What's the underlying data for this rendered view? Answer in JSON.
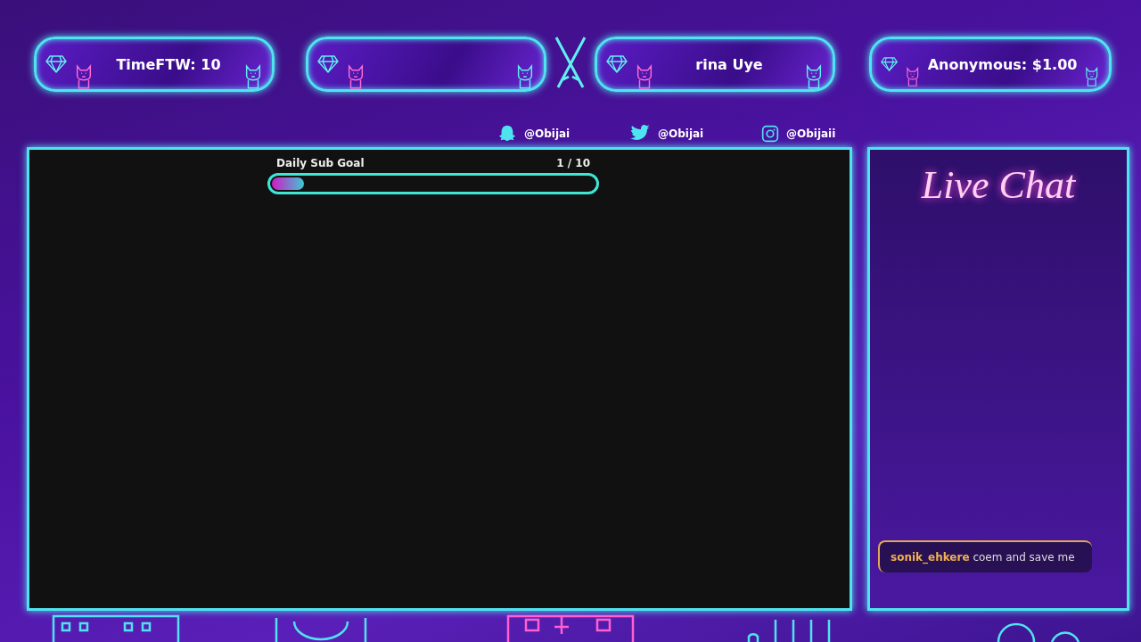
{
  "banners": [
    {
      "kind": "message",
      "text": "TimeFTW: 10"
    },
    {
      "kind": "blank"
    },
    {
      "kind": "message",
      "text": "rina Uye"
    },
    {
      "kind": "message",
      "text": "Anonymous: $1.00"
    }
  ],
  "socials": [
    {
      "kind": "snapchat",
      "handle": "@Obijai"
    },
    {
      "kind": "twitter",
      "handle": "@Obijai"
    },
    {
      "kind": "instagram",
      "handle": "@Obijaii"
    }
  ],
  "goal": {
    "title": "Daily Sub Goal",
    "count": "1 / 10",
    "level": 0.1
  },
  "chat": {
    "title": "Live Chat",
    "messages": [
      {
        "user": "sonik_ehkere",
        "text": "coem and save me"
      }
    ]
  }
}
